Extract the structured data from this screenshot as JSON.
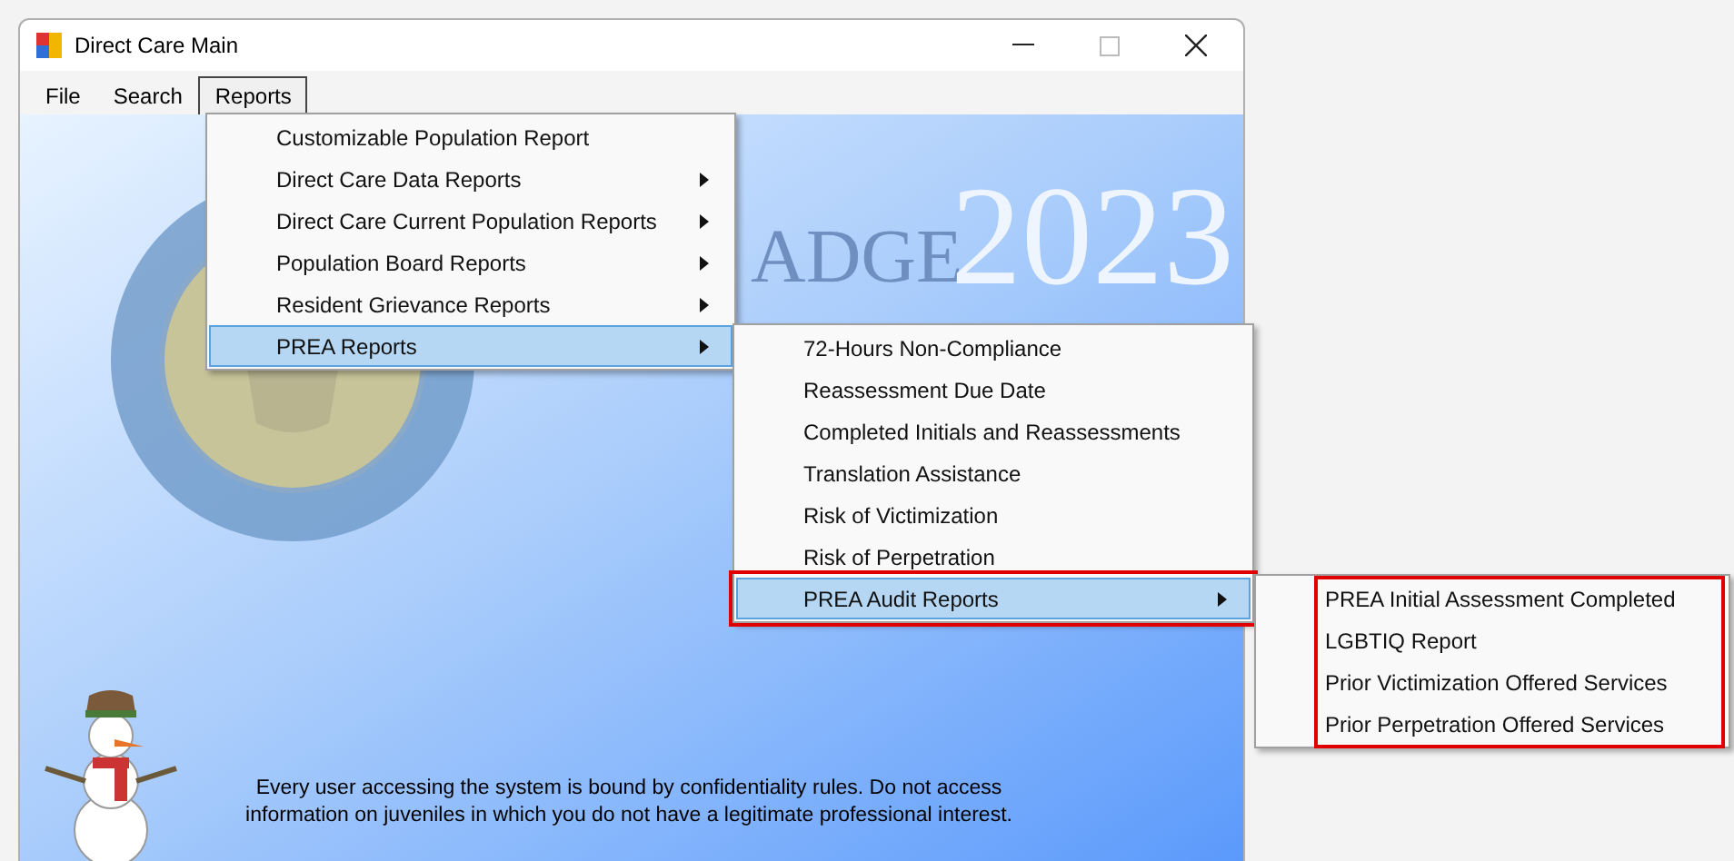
{
  "window": {
    "title": "Direct Care Main"
  },
  "menu_bar": [
    {
      "label": "File",
      "selected": false
    },
    {
      "label": "Search",
      "selected": false
    },
    {
      "label": "Reports",
      "selected": true
    }
  ],
  "background": {
    "heading": "ADGE",
    "year": "2023",
    "notice": [
      "Every user accessing the system is bound by confidentiality rules. Do not access",
      "information on juveniles in which you do not have a legitimate professional interest."
    ]
  },
  "reports_menu": {
    "highlighted": false,
    "items": [
      {
        "label": "Customizable Population Report",
        "has_submenu": false,
        "selected": false,
        "highlighted": false
      },
      {
        "label": "Direct Care Data Reports",
        "has_submenu": true,
        "selected": false,
        "highlighted": false
      },
      {
        "label": "Direct Care Current Population Reports",
        "has_submenu": true,
        "selected": false,
        "highlighted": false
      },
      {
        "label": "Population Board Reports",
        "has_submenu": true,
        "selected": false,
        "highlighted": false
      },
      {
        "label": "Resident Grievance Reports",
        "has_submenu": true,
        "selected": false,
        "highlighted": false
      },
      {
        "label": "PREA Reports",
        "has_submenu": true,
        "selected": true,
        "highlighted": false
      }
    ]
  },
  "prea_menu": {
    "highlighted": false,
    "items": [
      {
        "label": "72-Hours Non-Compliance",
        "has_submenu": false,
        "selected": false,
        "highlighted": false
      },
      {
        "label": "Reassessment Due Date",
        "has_submenu": false,
        "selected": false,
        "highlighted": false
      },
      {
        "label": "Completed Initials and Reassessments",
        "has_submenu": false,
        "selected": false,
        "highlighted": false
      },
      {
        "label": "Translation Assistance",
        "has_submenu": false,
        "selected": false,
        "highlighted": false
      },
      {
        "label": "Risk of Victimization",
        "has_submenu": false,
        "selected": false,
        "highlighted": false
      },
      {
        "label": "Risk of Perpetration",
        "has_submenu": false,
        "selected": false,
        "highlighted": false
      },
      {
        "label": "PREA Audit Reports",
        "has_submenu": true,
        "selected": true,
        "highlighted": true
      }
    ]
  },
  "audit_menu": {
    "highlighted": true,
    "items": [
      {
        "label": "PREA Initial Assessment Completed",
        "has_submenu": false,
        "selected": false,
        "highlighted": false
      },
      {
        "label": "LGBTIQ Report",
        "has_submenu": false,
        "selected": false,
        "highlighted": false
      },
      {
        "label": "Prior Victimization  Offered Services",
        "has_submenu": false,
        "selected": false,
        "highlighted": false
      },
      {
        "label": "Prior Perpetration  Offered Services",
        "has_submenu": false,
        "selected": false,
        "highlighted": false
      }
    ]
  }
}
